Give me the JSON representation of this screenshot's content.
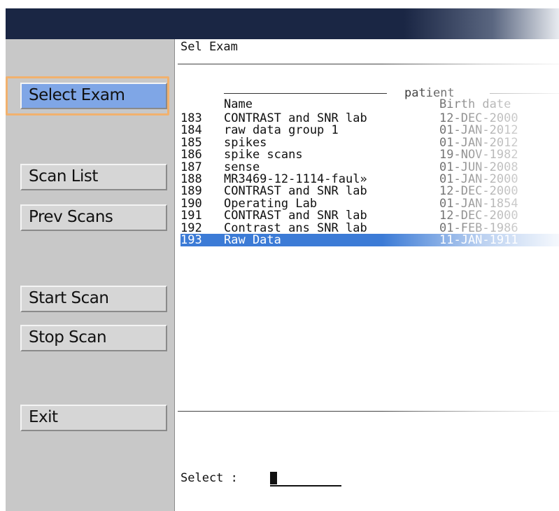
{
  "sidebar": {
    "buttons": {
      "select_exam": "Select Exam",
      "scan_list": "Scan List",
      "prev_scans": "Prev Scans",
      "start_scan": "Start Scan",
      "stop_scan": "Stop Scan",
      "exit": "Exit"
    },
    "active_button": "Select Exam",
    "active_color": "#7fa6e6",
    "focus_color": "#f1b16e"
  },
  "panel": {
    "title": "Sel Exam",
    "group_label": "patient",
    "columns": {
      "name": "Name",
      "birth_date": "Birth date"
    },
    "rows": [
      {
        "num": "183",
        "name": "CONTRAST and SNR lab",
        "birth_date": "12-DEC-2000"
      },
      {
        "num": "184",
        "name": "raw data group 1",
        "birth_date": "01-JAN-2012"
      },
      {
        "num": "185",
        "name": "spikes",
        "birth_date": "01-JAN-2012"
      },
      {
        "num": "186",
        "name": "spike scans",
        "birth_date": "19-NOV-1982"
      },
      {
        "num": "187",
        "name": "sense",
        "birth_date": "01-JUN-2008"
      },
      {
        "num": "188",
        "name": "MR3469-12-1114-faul»",
        "birth_date": "01-JAN-2000"
      },
      {
        "num": "189",
        "name": "CONTRAST and SNR lab",
        "birth_date": "12-DEC-2000"
      },
      {
        "num": "190",
        "name": "Operating Lab",
        "birth_date": "01-JAN-1854"
      },
      {
        "num": "191",
        "name": "CONTRAST and SNR lab",
        "birth_date": "12-DEC-2000"
      },
      {
        "num": "192",
        "name": "Contrast ans SNR lab",
        "birth_date": "01-FEB-1986"
      },
      {
        "num": "193",
        "name": "Raw Data",
        "birth_date": "11-JAN-1911"
      }
    ],
    "selected_row": "193",
    "selection_color": "#3c7bd6",
    "prompt": "Select :"
  },
  "titlebar_color": "#1a2644"
}
